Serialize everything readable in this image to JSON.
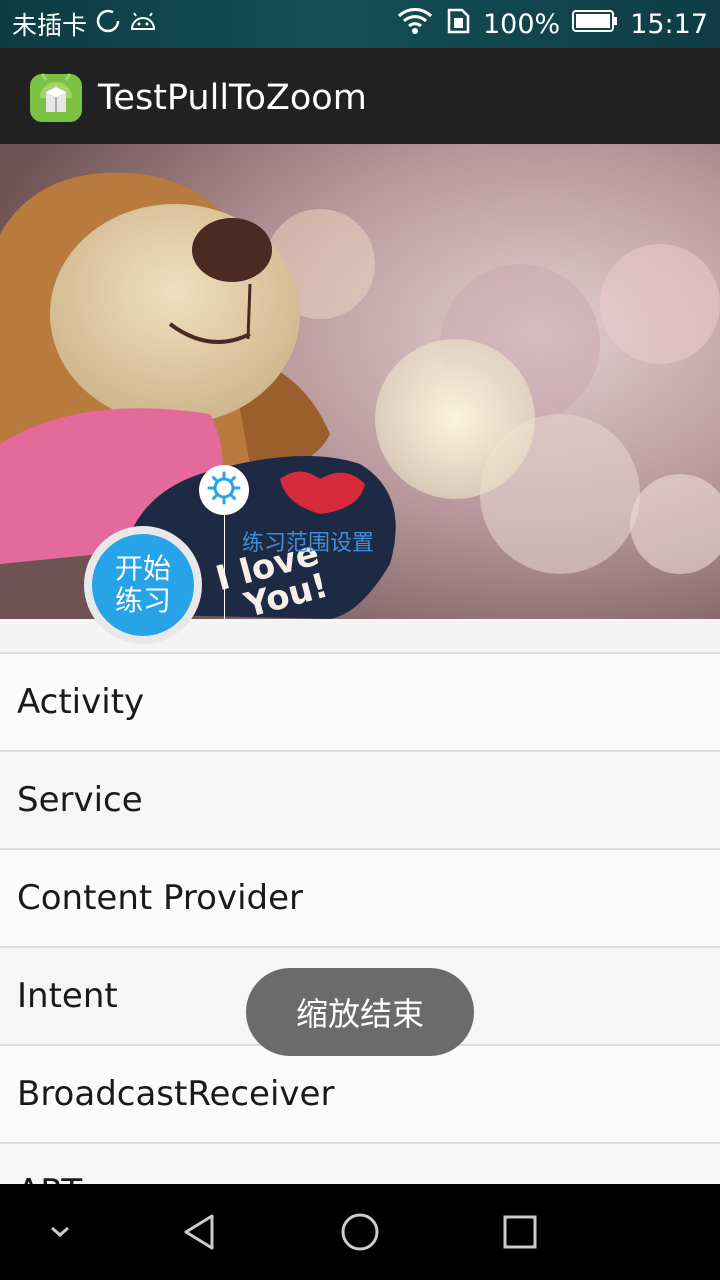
{
  "status_bar": {
    "carrier": "未插卡",
    "battery": "100%",
    "time": "15:17",
    "icons": [
      "sync-icon",
      "android-icon",
      "wifi-icon",
      "sim-icon",
      "battery-icon"
    ]
  },
  "action_bar": {
    "title": "TestPullToZoom",
    "icon": "android-app-icon"
  },
  "header": {
    "settings_label": "练习范围设置",
    "start_button_line1": "开始",
    "start_button_line2": "练习"
  },
  "list": {
    "items": [
      "Activity",
      "Service",
      "Content Provider",
      "Intent",
      "BroadcastReceiver",
      "ART"
    ]
  },
  "toast": {
    "message": "缩放结束"
  },
  "nav_bar": {
    "icons": [
      "chevron-down-icon",
      "back-icon",
      "home-icon",
      "recents-icon"
    ]
  },
  "colors": {
    "accent": "#27a3e8",
    "action_bar": "#212121",
    "toast_bg": "#6b6b6b"
  }
}
